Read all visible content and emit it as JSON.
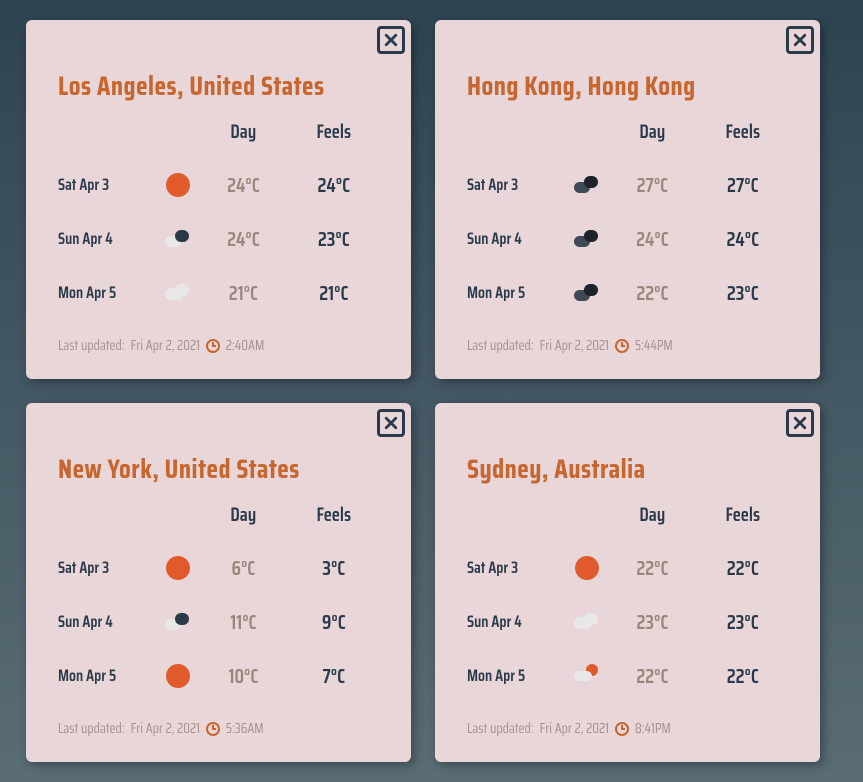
{
  "headers": {
    "day": "Day",
    "feels": "Feels"
  },
  "last_updated_label": "Last updated: ",
  "cards": [
    {
      "location": "Los Angeles, United States",
      "rows": [
        {
          "date": "Sat Apr 3",
          "icon": "sunny",
          "day": "24°C",
          "feels": "24°C"
        },
        {
          "date": "Sun Apr 4",
          "icon": "partly",
          "day": "24°C",
          "feels": "23°C"
        },
        {
          "date": "Mon Apr 5",
          "icon": "cloudy",
          "day": "21°C",
          "feels": "21°C"
        }
      ],
      "updated_date": "Fri Apr 2, 2021",
      "updated_time": "2:40AM"
    },
    {
      "location": "Hong Kong, Hong Kong",
      "rows": [
        {
          "date": "Sat Apr 3",
          "icon": "darkcloud",
          "day": "27°C",
          "feels": "27°C"
        },
        {
          "date": "Sun Apr 4",
          "icon": "darkcloud",
          "day": "24°C",
          "feels": "24°C"
        },
        {
          "date": "Mon Apr 5",
          "icon": "darkcloud",
          "day": "22°C",
          "feels": "23°C"
        }
      ],
      "updated_date": "Fri Apr 2, 2021",
      "updated_time": "5:44PM"
    },
    {
      "location": "New York, United States",
      "rows": [
        {
          "date": "Sat Apr 3",
          "icon": "sunny",
          "day": "6°C",
          "feels": "3°C"
        },
        {
          "date": "Sun Apr 4",
          "icon": "partly",
          "day": "11°C",
          "feels": "9°C"
        },
        {
          "date": "Mon Apr 5",
          "icon": "sunny",
          "day": "10°C",
          "feels": "7°C"
        }
      ],
      "updated_date": "Fri Apr 2, 2021",
      "updated_time": "5:36AM"
    },
    {
      "location": "Sydney, Australia",
      "rows": [
        {
          "date": "Sat Apr 3",
          "icon": "sunny",
          "day": "22°C",
          "feels": "22°C"
        },
        {
          "date": "Sun Apr 4",
          "icon": "cloudy",
          "day": "23°C",
          "feels": "23°C"
        },
        {
          "date": "Mon Apr 5",
          "icon": "snow-sun",
          "day": "22°C",
          "feels": "22°C"
        }
      ],
      "updated_date": "Fri Apr 2, 2021",
      "updated_time": "8:41PM"
    }
  ]
}
